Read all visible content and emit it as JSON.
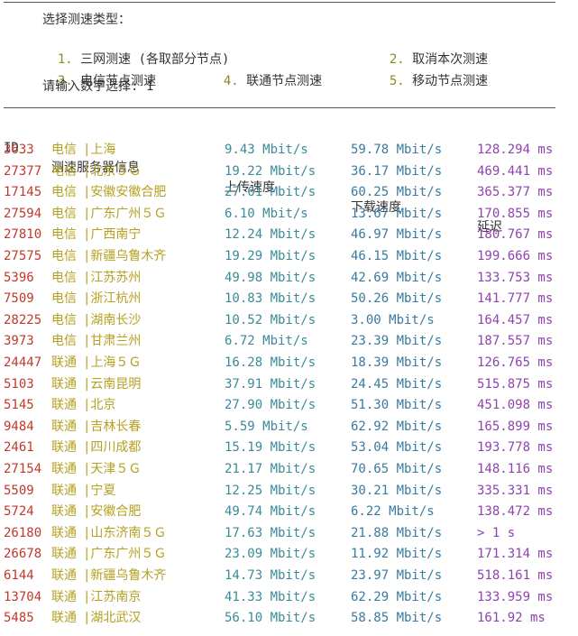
{
  "menu": {
    "title": "选择测速类型：",
    "items": [
      {
        "num": "1.",
        "label": "三网测速 (各取部分节点)"
      },
      {
        "num": "2.",
        "label": "取消本次测速"
      },
      {
        "num": "3.",
        "label": "电信节点测速"
      },
      {
        "num": "4.",
        "label": "联通节点测速"
      },
      {
        "num": "5.",
        "label": "移动节点测速"
      }
    ],
    "prompt": "请输入数字选择: 1"
  },
  "table": {
    "headers": {
      "id": "ID",
      "server": "测速服务器信息",
      "upload": "上传速度",
      "download": "下载速度",
      "latency": "延迟"
    },
    "rows": [
      {
        "id": "3633",
        "isp": "电信",
        "city": "|上海",
        "up": "9.43 Mbit/s",
        "down": "59.78 Mbit/s",
        "lat": "128.294 ms"
      },
      {
        "id": "27377",
        "isp": "电信",
        "city": "|北京５Ｇ",
        "up": "19.22 Mbit/s",
        "down": "36.17 Mbit/s",
        "lat": "469.441 ms"
      },
      {
        "id": "17145",
        "isp": "电信",
        "city": "|安徽安徽合肥",
        "up": "27.61 Mbit/s",
        "down": "60.25 Mbit/s",
        "lat": "365.377 ms"
      },
      {
        "id": "27594",
        "isp": "电信",
        "city": "|广东广州５Ｇ",
        "up": "6.10 Mbit/s",
        "down": "13.67 Mbit/s",
        "lat": "170.855 ms"
      },
      {
        "id": "27810",
        "isp": "电信",
        "city": "|广西南宁",
        "up": "12.24 Mbit/s",
        "down": "46.97 Mbit/s",
        "lat": "180.767 ms"
      },
      {
        "id": "27575",
        "isp": "电信",
        "city": "|新疆乌鲁木齐",
        "up": "19.29 Mbit/s",
        "down": "46.15 Mbit/s",
        "lat": "199.666 ms"
      },
      {
        "id": "5396",
        "isp": "电信",
        "city": "|江苏苏州",
        "up": "49.98 Mbit/s",
        "down": "42.69 Mbit/s",
        "lat": "133.753 ms"
      },
      {
        "id": "7509",
        "isp": "电信",
        "city": "|浙江杭州",
        "up": "10.83 Mbit/s",
        "down": "50.26 Mbit/s",
        "lat": "141.777 ms"
      },
      {
        "id": "28225",
        "isp": "电信",
        "city": "|湖南长沙",
        "up": "10.52 Mbit/s",
        "down": "3.00 Mbit/s",
        "lat": "164.457 ms"
      },
      {
        "id": "3973",
        "isp": "电信",
        "city": "|甘肃兰州",
        "up": "6.72 Mbit/s",
        "down": "23.39 Mbit/s",
        "lat": "187.557 ms"
      },
      {
        "id": "24447",
        "isp": "联通",
        "city": "|上海５Ｇ",
        "up": "16.28 Mbit/s",
        "down": "18.39 Mbit/s",
        "lat": "126.765 ms"
      },
      {
        "id": "5103",
        "isp": "联通",
        "city": "|云南昆明",
        "up": "37.91 Mbit/s",
        "down": "24.45 Mbit/s",
        "lat": "515.875 ms"
      },
      {
        "id": "5145",
        "isp": "联通",
        "city": "|北京",
        "up": "27.90 Mbit/s",
        "down": "51.30 Mbit/s",
        "lat": "451.098 ms"
      },
      {
        "id": "9484",
        "isp": "联通",
        "city": "|吉林长春",
        "up": "5.59 Mbit/s",
        "down": "62.92 Mbit/s",
        "lat": "165.899 ms"
      },
      {
        "id": "2461",
        "isp": "联通",
        "city": "|四川成都",
        "up": "15.19 Mbit/s",
        "down": "53.04 Mbit/s",
        "lat": "193.778 ms"
      },
      {
        "id": "27154",
        "isp": "联通",
        "city": "|天津５Ｇ",
        "up": "21.17 Mbit/s",
        "down": "70.65 Mbit/s",
        "lat": "148.116 ms"
      },
      {
        "id": "5509",
        "isp": "联通",
        "city": "|宁夏",
        "up": "12.25 Mbit/s",
        "down": "30.21 Mbit/s",
        "lat": "335.331 ms"
      },
      {
        "id": "5724",
        "isp": "联通",
        "city": "|安徽合肥",
        "up": "49.74 Mbit/s",
        "down": "6.22 Mbit/s",
        "lat": "138.472 ms"
      },
      {
        "id": "26180",
        "isp": "联通",
        "city": "|山东济南５Ｇ",
        "up": "17.63 Mbit/s",
        "down": "21.88 Mbit/s",
        "lat": "> 1 s"
      },
      {
        "id": "26678",
        "isp": "联通",
        "city": "|广东广州５Ｇ",
        "up": "23.09 Mbit/s",
        "down": "11.92 Mbit/s",
        "lat": "171.314 ms"
      },
      {
        "id": "6144",
        "isp": "联通",
        "city": "|新疆乌鲁木齐",
        "up": "14.73 Mbit/s",
        "down": "23.97 Mbit/s",
        "lat": "518.161 ms"
      },
      {
        "id": "13704",
        "isp": "联通",
        "city": "|江苏南京",
        "up": "41.33 Mbit/s",
        "down": "62.29 Mbit/s",
        "lat": "133.959 ms"
      },
      {
        "id": "5485",
        "isp": "联通",
        "city": "|湖北武汉",
        "up": "56.10 Mbit/s",
        "down": "58.85 Mbit/s",
        "lat": "161.92 ms"
      }
    ]
  }
}
